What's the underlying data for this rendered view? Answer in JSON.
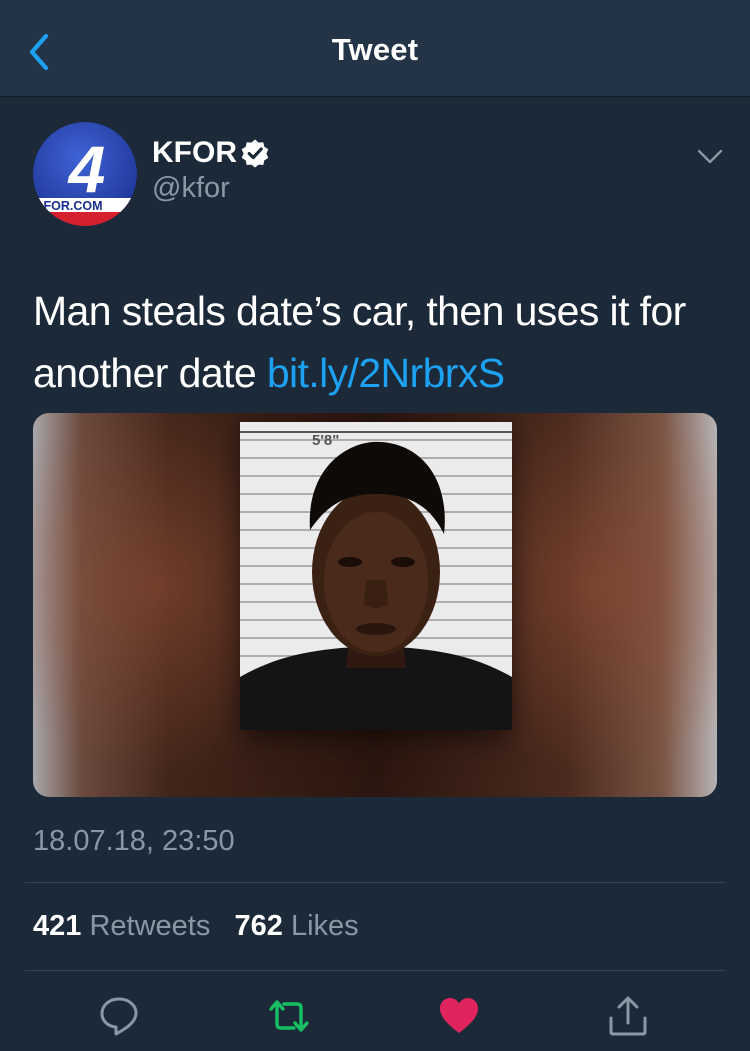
{
  "nav": {
    "title": "Tweet"
  },
  "tweet": {
    "author": {
      "name": "KFOR",
      "handle": "@kfor",
      "avatar_text": "FOR.COM"
    },
    "text": "Man steals date’s car, then uses it for another date ",
    "link": "bit.ly/2NrbrxS",
    "media": {
      "height_label": "5'8\""
    },
    "timestamp": "18.07.18, 23:50",
    "stats": {
      "retweets_count": "421",
      "retweets_label": "Retweets",
      "likes_count": "762",
      "likes_label": "Likes"
    }
  },
  "icons": {
    "back": "chevron-left-icon",
    "verified": "verified-badge-icon",
    "more": "chevron-down-icon",
    "reply": "reply-icon",
    "retweet": "retweet-icon",
    "like": "heart-icon",
    "share": "share-icon"
  },
  "colors": {
    "background": "#1c2938",
    "navbar": "#243447",
    "accent": "#1da1f2",
    "secondary_text": "#8899a6",
    "retweet": "#17bf63",
    "like": "#e0245e"
  }
}
